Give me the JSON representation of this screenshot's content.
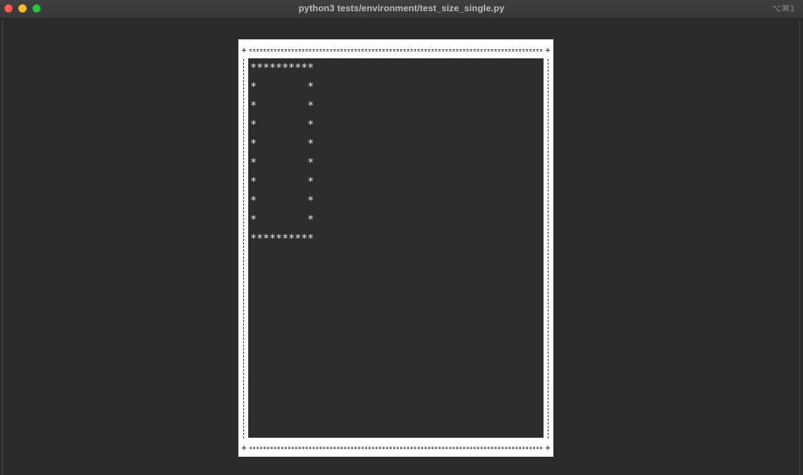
{
  "window": {
    "title": "python3 tests/environment/test_size_single.py",
    "shortcut": "⌥⌘1",
    "controls": {
      "close_color": "#fe5f57",
      "minimize_color": "#febc2e",
      "maximize_color": "#28c840"
    }
  },
  "terminal": {
    "background": "#2b2b2b",
    "screen_background": "#2d2d2d",
    "frame_color": "#ffffff",
    "border_corner_glyph": "+",
    "output_lines": [
      "**********",
      "*        *",
      "*        *",
      "*        *",
      "*        *",
      "*        *",
      "*        *",
      "*        *",
      "*        *",
      "**********"
    ]
  }
}
